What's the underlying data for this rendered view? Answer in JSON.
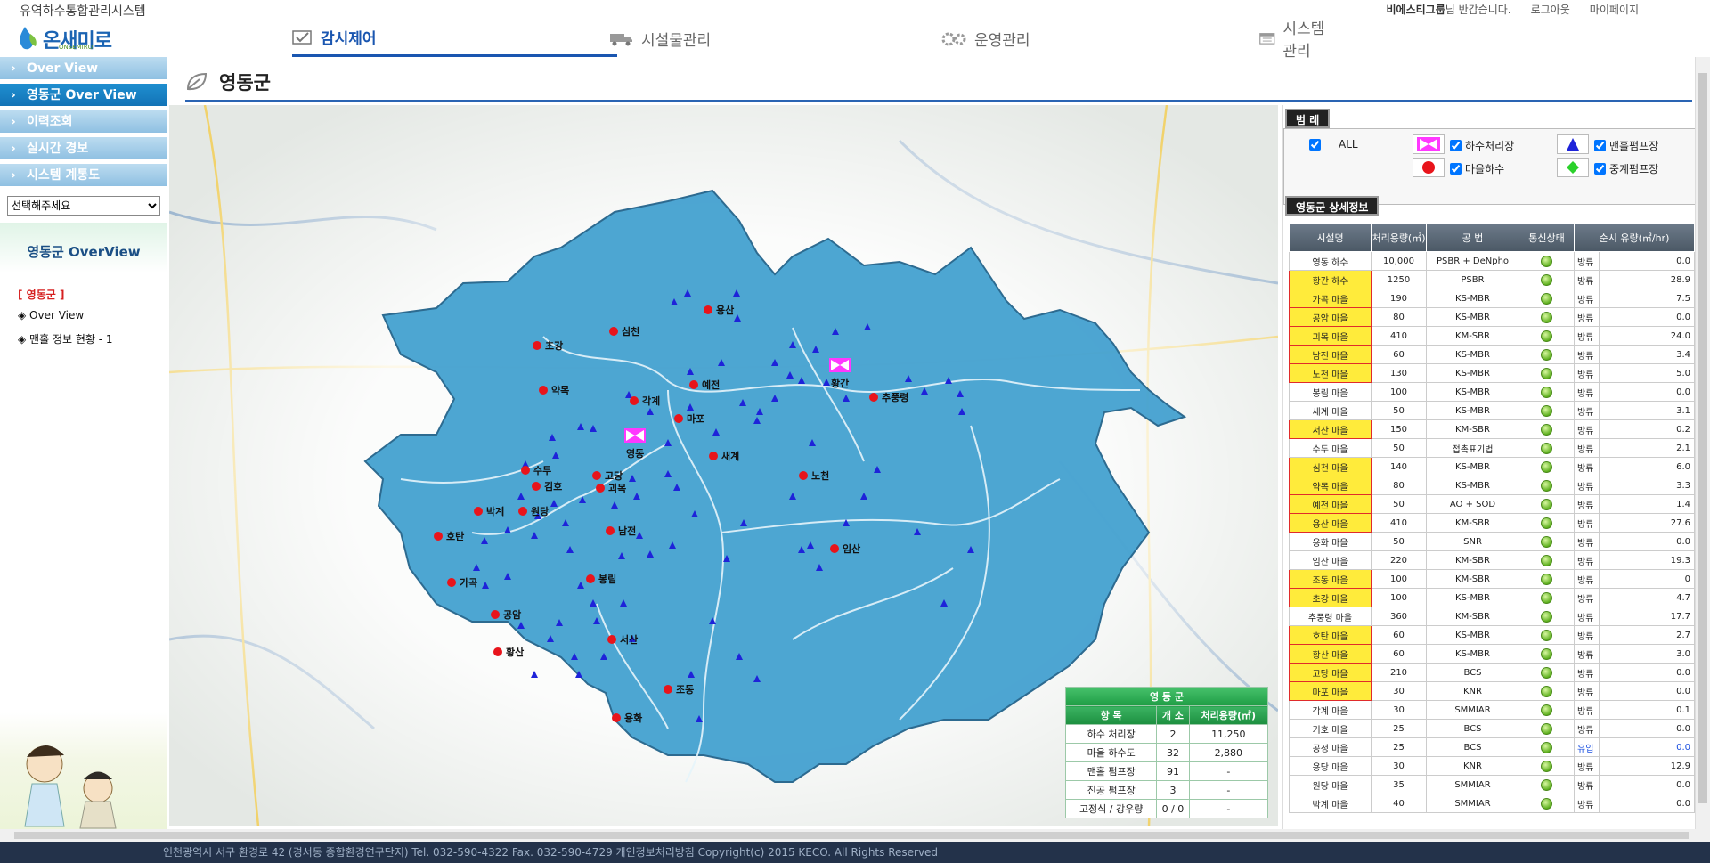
{
  "header": {
    "app_title": "유역하수통합관리시스템",
    "logo_text": "온새미로",
    "logo_sub": "ONSEMIRO",
    "user_name": "비에스티그룹",
    "greeting": "님 반갑습니다.",
    "logout": "로그아웃",
    "mypage": "마이페이지"
  },
  "nav": [
    {
      "label": "감시제어",
      "icon": "monitor-check-icon"
    },
    {
      "label": "시설물관리",
      "icon": "truck-icon"
    },
    {
      "label": "운영관리",
      "icon": "gear-icon"
    },
    {
      "label": "시스템관리",
      "icon": "calendar-icon"
    }
  ],
  "sidebar": {
    "items": [
      {
        "label": "Over View"
      },
      {
        "label": "영동군 Over View"
      },
      {
        "label": "이력조회"
      },
      {
        "label": "실시간 경보"
      },
      {
        "label": "시스템 계통도"
      }
    ],
    "select_value": "선택해주세요",
    "overview_title": "영동군 OverView",
    "tree_root": "[ 영동군 ]",
    "tree_items": [
      "◈ Over View",
      "◈ 맨홀 정보 현황 - 1"
    ]
  },
  "page": {
    "title": "영동군"
  },
  "map": {
    "colors": {
      "region": "#3f9fcf",
      "village": "#e8141b",
      "pump": "#1e23d9",
      "plant": "#ff38ff"
    },
    "labels": [
      "용산",
      "심천",
      "초강",
      "약목",
      "각계",
      "예전",
      "마포",
      "황간",
      "추풍령",
      "영동",
      "새계",
      "고당",
      "수두",
      "김호",
      "괴목",
      "노천",
      "박계",
      "원당",
      "남전",
      "호탄",
      "임산",
      "봉림",
      "가곡",
      "공암",
      "서산",
      "황산",
      "조동",
      "용화"
    ]
  },
  "stats": {
    "caption": "영 동 군",
    "headers": [
      "항 목",
      "개 소",
      "처리용량(㎥)"
    ],
    "rows": [
      [
        "하수 처리장",
        "2",
        "11,250"
      ],
      [
        "마을 하수도",
        "32",
        "2,880"
      ],
      [
        "맨홀 펌프장",
        "91",
        "-"
      ],
      [
        "진공 펌프장",
        "3",
        "-"
      ],
      [
        "고정식 / 강우량",
        "0 / 0",
        "-"
      ]
    ]
  },
  "legend": {
    "caption": "범 례",
    "all": "ALL",
    "plant": "하수처리장",
    "manhole_pump": "맨홀펌프장",
    "village": "마을하수",
    "relay_pump": "중계펌프장"
  },
  "detail": {
    "caption": "영동군 상세정보",
    "headers": [
      "시설명",
      "처리용량(㎥)",
      "공 법",
      "통신상태",
      "순시 유량(㎥/hr)"
    ],
    "rows": [
      {
        "name": "영동 하수",
        "cap": "10,000",
        "method": "PSBR + DeNpho",
        "dir": "방류",
        "flow": "0.0",
        "hl": false
      },
      {
        "name": "황간 하수",
        "cap": "1250",
        "method": "PSBR",
        "dir": "방류",
        "flow": "28.9",
        "hl": true
      },
      {
        "name": "가곡 마을",
        "cap": "190",
        "method": "KS-MBR",
        "dir": "방류",
        "flow": "7.5",
        "hl": true
      },
      {
        "name": "공암 마을",
        "cap": "80",
        "method": "KS-MBR",
        "dir": "방류",
        "flow": "0.0",
        "hl": true
      },
      {
        "name": "괴목 마을",
        "cap": "410",
        "method": "KM-SBR",
        "dir": "방류",
        "flow": "24.0",
        "hl": true
      },
      {
        "name": "남전 마을",
        "cap": "60",
        "method": "KS-MBR",
        "dir": "방류",
        "flow": "3.4",
        "hl": true
      },
      {
        "name": "노천 마을",
        "cap": "130",
        "method": "KS-MBR",
        "dir": "방류",
        "flow": "5.0",
        "hl": true
      },
      {
        "name": "봉림 마을",
        "cap": "100",
        "method": "KS-MBR",
        "dir": "방류",
        "flow": "0.0",
        "hl": false
      },
      {
        "name": "새계 마을",
        "cap": "50",
        "method": "KS-MBR",
        "dir": "방류",
        "flow": "3.1",
        "hl": false
      },
      {
        "name": "서산 마을",
        "cap": "150",
        "method": "KM-SBR",
        "dir": "방류",
        "flow": "0.2",
        "hl": true
      },
      {
        "name": "수두 마을",
        "cap": "50",
        "method": "접촉표기법",
        "dir": "방류",
        "flow": "2.1",
        "hl": false
      },
      {
        "name": "심천 마을",
        "cap": "140",
        "method": "KS-MBR",
        "dir": "방류",
        "flow": "6.0",
        "hl": true
      },
      {
        "name": "약목 마을",
        "cap": "80",
        "method": "KS-MBR",
        "dir": "방류",
        "flow": "3.3",
        "hl": true
      },
      {
        "name": "예전 마을",
        "cap": "50",
        "method": "AO + SOD",
        "dir": "방류",
        "flow": "1.4",
        "hl": true
      },
      {
        "name": "용산 마을",
        "cap": "410",
        "method": "KM-SBR",
        "dir": "방류",
        "flow": "27.6",
        "hl": true
      },
      {
        "name": "용화 마을",
        "cap": "50",
        "method": "SNR",
        "dir": "방류",
        "flow": "0.0",
        "hl": false
      },
      {
        "name": "임산 마을",
        "cap": "220",
        "method": "KM-SBR",
        "dir": "방류",
        "flow": "19.3",
        "hl": false
      },
      {
        "name": "조동 마을",
        "cap": "100",
        "method": "KM-SBR",
        "dir": "방류",
        "flow": "0",
        "hl": true
      },
      {
        "name": "초강 마을",
        "cap": "100",
        "method": "KS-MBR",
        "dir": "방류",
        "flow": "4.7",
        "hl": true
      },
      {
        "name": "추풍령 마을",
        "cap": "360",
        "method": "KM-SBR",
        "dir": "방류",
        "flow": "17.7",
        "hl": false
      },
      {
        "name": "호탄 마을",
        "cap": "60",
        "method": "KS-MBR",
        "dir": "방류",
        "flow": "2.7",
        "hl": true
      },
      {
        "name": "황산 마을",
        "cap": "60",
        "method": "KS-MBR",
        "dir": "방류",
        "flow": "3.0",
        "hl": true
      },
      {
        "name": "고당 마을",
        "cap": "210",
        "method": "BCS",
        "dir": "방류",
        "flow": "0.0",
        "hl": true
      },
      {
        "name": "마포 마을",
        "cap": "30",
        "method": "KNR",
        "dir": "방류",
        "flow": "0.0",
        "hl": true
      },
      {
        "name": "각계 마을",
        "cap": "30",
        "method": "SMMIAR",
        "dir": "방류",
        "flow": "0.1",
        "hl": false
      },
      {
        "name": "기호 마을",
        "cap": "25",
        "method": "BCS",
        "dir": "방류",
        "flow": "0.0",
        "hl": false
      },
      {
        "name": "공정 마을",
        "cap": "25",
        "method": "BCS",
        "dir": "유입",
        "flow": "0.0",
        "hl": false
      },
      {
        "name": "용당 마을",
        "cap": "30",
        "method": "KNR",
        "dir": "방류",
        "flow": "12.9",
        "hl": false
      },
      {
        "name": "원당 마을",
        "cap": "35",
        "method": "SMMIAR",
        "dir": "방류",
        "flow": "0.0",
        "hl": false
      },
      {
        "name": "박계 마을",
        "cap": "40",
        "method": "SMMIAR",
        "dir": "방류",
        "flow": "0.0",
        "hl": false
      }
    ]
  },
  "footer": "인천광역시 서구 환경로 42 (경서동 종합환경연구단지) Tel. 032-590-4322 Fax. 032-590-4729 개인정보처리방침 Copyright(c) 2015 KECO. All Rights Reserved"
}
